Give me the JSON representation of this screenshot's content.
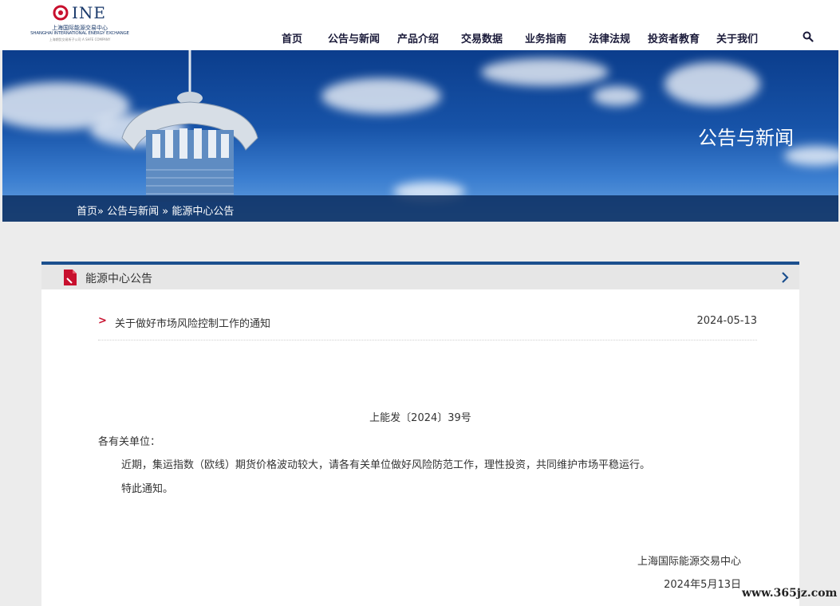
{
  "logo": {
    "mark": "INE",
    "name_cn": "上海国际能源交易中心",
    "name_en": "SHANGHAI INTERNATIONAL ENERGY EXCHANGE",
    "subline": "上海期货交易所子公司  A SHFE COMPANY"
  },
  "nav": {
    "items": [
      "首页",
      "公告与新闻",
      "产品介绍",
      "交易数据",
      "业务指南",
      "法律法规",
      "投资者教育",
      "关于我们"
    ],
    "search_icon": "search-icon"
  },
  "banner": {
    "title": "公告与新闻"
  },
  "breadcrumb": {
    "home": "首页»",
    "section": "公告与新闻",
    "sep": "»",
    "current": "能源中心公告"
  },
  "panel": {
    "title": "能源中心公告",
    "icon": "document-icon",
    "arrow_icon": "chevron-right-icon"
  },
  "news": {
    "bullet": ">",
    "title": "关于做好市场风险控制工作的通知",
    "date": "2024-05-13"
  },
  "article": {
    "doc_no": "上能发〔2024〕39号",
    "salutation": "各有关单位：",
    "body": "近期，集运指数（欧线）期货价格波动较大，请各有关单位做好风险防范工作，理性投资，共同维护市场平稳运行。",
    "closing": "特此通知。",
    "signer": "上海国际能源交易中心",
    "sign_date": "2024年5月13日"
  },
  "watermark": "www.365jz.com",
  "colors": {
    "brand": "#1b4f8e",
    "accent_red": "#c8102e",
    "nav_text": "#1b1b3a"
  }
}
